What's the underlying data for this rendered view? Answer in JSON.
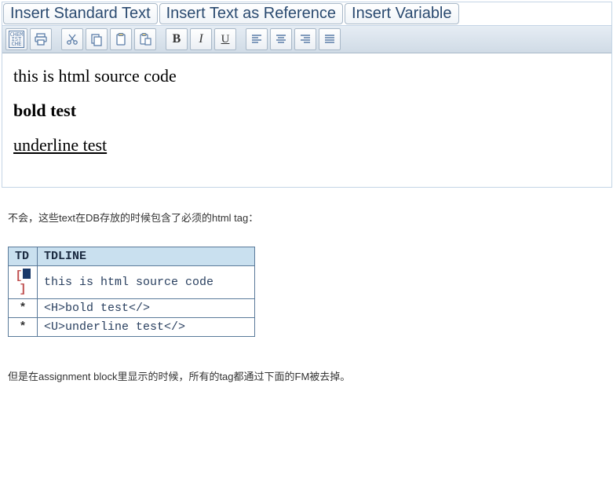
{
  "header_buttons": {
    "insert_std": "Insert Standard Text",
    "insert_ref": "Insert Text as Reference",
    "insert_var": "Insert Variable"
  },
  "toolbar": {
    "bold": "B",
    "italic": "I",
    "underline": "U"
  },
  "editor": {
    "line1": "this is html source code",
    "line2": "bold test",
    "line3": "underline test"
  },
  "para1": "不会，这些text在DB存放的时候包含了必须的html tag：",
  "db_table": {
    "headers": {
      "c1": "TD",
      "c2": "TDLINE"
    },
    "rows": [
      {
        "td": "marker",
        "tdline": "this is html source code"
      },
      {
        "td": "*",
        "tdline": "<H>bold test</>"
      },
      {
        "td": "*",
        "tdline": "<U>underline test</>"
      }
    ]
  },
  "para2": "但是在assignment block里显示的时候，所有的tag都通过下面的FM被去掉。"
}
